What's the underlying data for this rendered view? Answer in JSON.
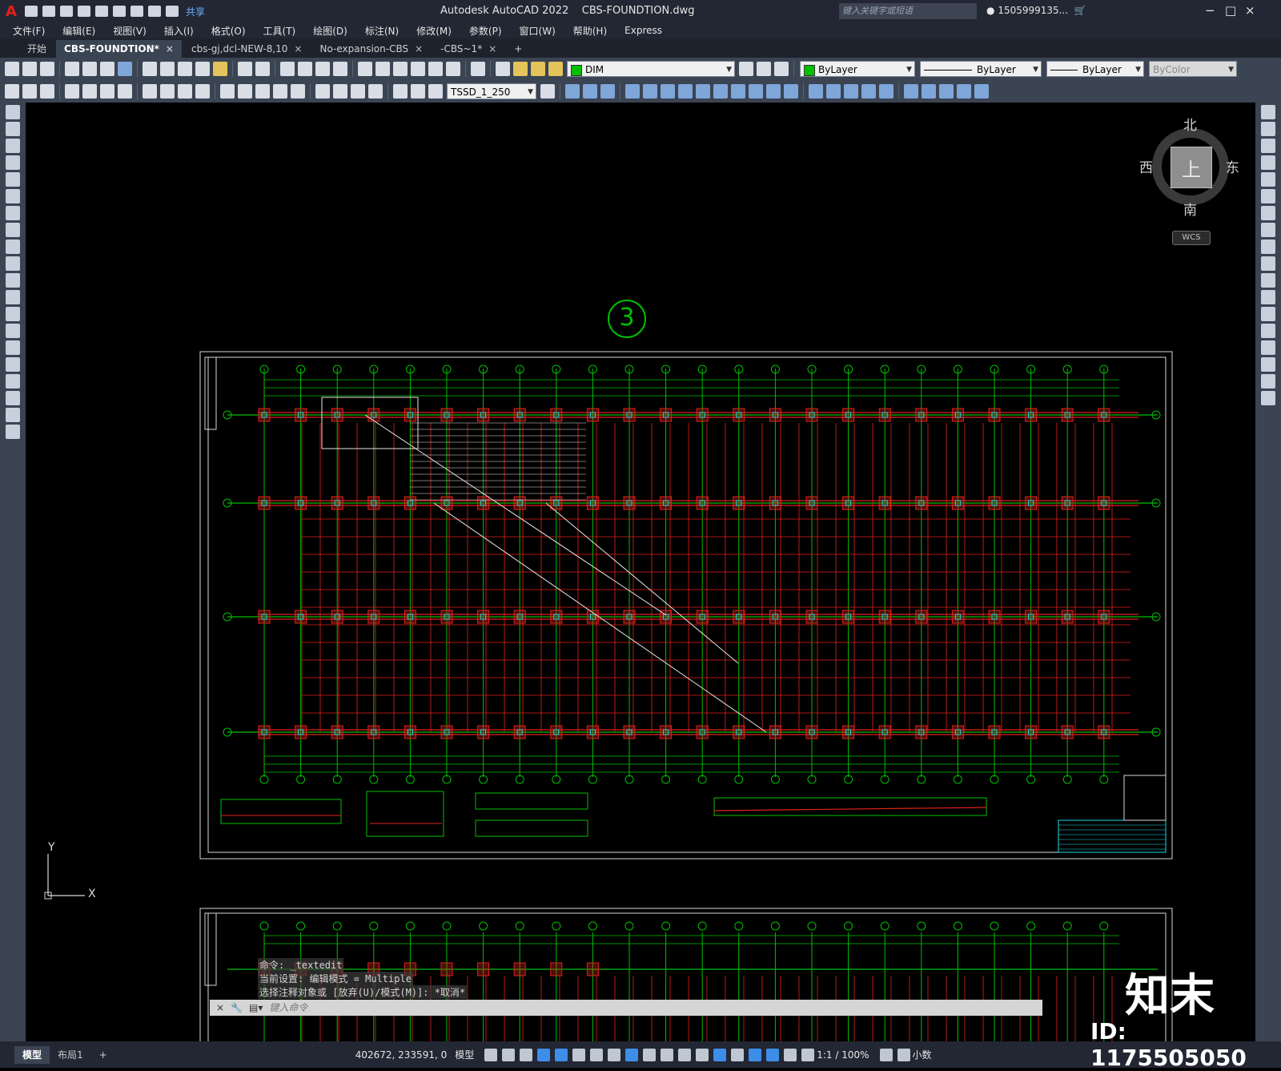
{
  "window": {
    "app_title": "Autodesk AutoCAD 2022",
    "file_title": "CBS-FOUNDTION.dwg",
    "search_placeholder": "键入关键字或短语",
    "user": "1505999135...",
    "share": "共享",
    "app_letter": "A"
  },
  "menu": [
    "文件(F)",
    "编辑(E)",
    "视图(V)",
    "插入(I)",
    "格式(O)",
    "工具(T)",
    "绘图(D)",
    "标注(N)",
    "修改(M)",
    "参数(P)",
    "窗口(W)",
    "帮助(H)",
    "Express"
  ],
  "tabs": [
    {
      "label": "开始",
      "close": ""
    },
    {
      "label": "CBS-FOUNDTION*",
      "close": "×"
    },
    {
      "label": "cbs-gj,dcl-NEW-8,10",
      "close": "×"
    },
    {
      "label": "No-expansion-CBS",
      "close": "×"
    },
    {
      "label": "-CBS~1*",
      "close": "×"
    },
    {
      "label": "+",
      "close": ""
    }
  ],
  "toolbar": {
    "layer": "DIM",
    "color": "ByLayer",
    "linetype": "ByLayer",
    "lineweight": "ByLayer",
    "plotstyle": "ByColor",
    "dimstyle": "TSSD_1_250"
  },
  "viewcube": {
    "north": "北",
    "south": "南",
    "east": "东",
    "west": "西",
    "top": "上",
    "wcs": "WCS"
  },
  "drawing": {
    "number": "3"
  },
  "command": {
    "history": [
      "命令: _textedit",
      "当前设置: 编辑模式 = Multiple",
      "选择注释对象或 [放弃(U)/模式(M)]: *取消*"
    ],
    "placeholder": "键入命令"
  },
  "ucs": {
    "x": "X",
    "y": "Y"
  },
  "layouts": [
    "模型",
    "布局1",
    "+"
  ],
  "status": {
    "coords": "402672, 233591, 0",
    "space": "模型",
    "scale": "1:1 / 100%",
    "units": "小数"
  },
  "watermark": {
    "brand": "知末",
    "id": "ID: 1175505050"
  },
  "colors": {
    "accent": "#3d8ee8",
    "green": "#00c000",
    "red": "#e0221c",
    "cyan": "#19d9e8"
  }
}
